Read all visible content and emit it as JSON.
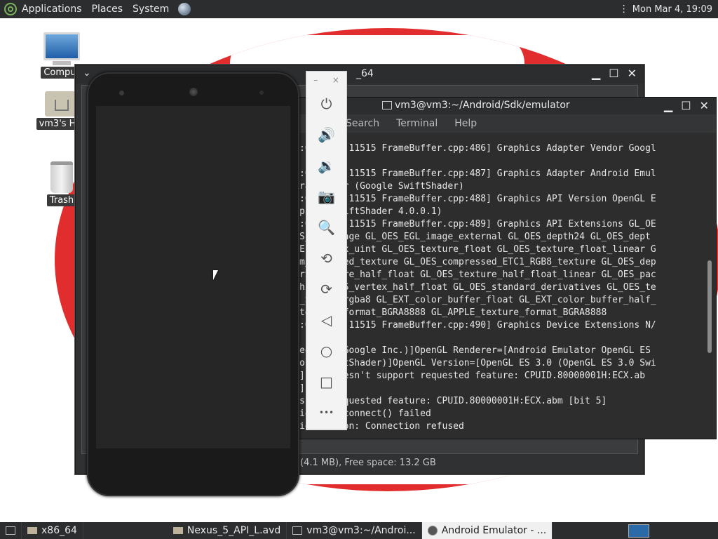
{
  "top_panel": {
    "menus": [
      "Applications",
      "Places",
      "System"
    ],
    "clock": "Mon Mar  4, 19:09"
  },
  "desktop": {
    "icons": [
      {
        "label": "Comput",
        "icon": "computer-icon"
      },
      {
        "label": "vm3's Ho",
        "icon": "home-folder-icon"
      },
      {
        "label": "Trash",
        "icon": "trash-icon"
      }
    ]
  },
  "avd_window": {
    "title": "_64",
    "status": "(4.1 MB), Free space: 13.2 GB"
  },
  "terminal": {
    "title": "vm3@vm3:~/Android/Sdk/emulator",
    "menus": [
      "Search",
      "Terminal",
      "Help"
    ],
    "lines": [
      ":06361   11515 FrameBuffer.cpp:486] Graphics Adapter Vendor Googl",
      "",
      ":06403   11515 FrameBuffer.cpp:487] Graphics Adapter Android Emul",
      "ranslator (Google SwiftShader)",
      ":06409   11515 FrameBuffer.cpp:488] Graphics API Version OpenGL E",
      "p 3.0 SwiftShader 4.0.0.1)",
      ":06413   11515 FrameBuffer.cpp:489] Graphics API Extensions GL_OE",
      "S_EGL_image GL_OES_EGL_image_external GL_OES_depth24 GL_OES_dept",
      "Ent_index_uint GL_OES_texture_float GL_OES_texture_float_linear G",
      "m_paletted_texture GL_OES_compressed_ETC1_RGB8_texture GL_OES_dep",
      "rS_texture_half_float GL_OES_texture_half_float_linear GL_OES_pac",
      "h. GL_OES_vertex_half_float GL_OES_standard_derivatives GL_OES_te",
      "_S_rgb8_rgba8 GL_EXT_color_buffer_float GL_EXT_color_buffer_half_",
      "texture_format_BGRA8888 GL_APPLE_texture_format_BGRA8888",
      ":06429   11515 FrameBuffer.cpp:490] Graphics Device Extensions N/",
      "",
      "eoogle (Google Inc.)]OpenGL Renderer=[Android Emulator OpenGL ES",
      "ole SwiftShader)]OpenGL Version=[OpenGL ES 3.0 (OpenGL ES 3.0 Swi",
      "]host doesn't support requested feature: CPUID.80000001H:ECX.ab",
      "]",
      "sport requested feature: CPUID.80000001H:ECX.abm [bit 5]",
      "iontext_connect() failed",
      "io: Reason: Connection refused"
    ]
  },
  "emulator_toolbar": {
    "buttons": [
      {
        "name": "power-icon",
        "glyph": "⏻"
      },
      {
        "name": "volume-up-icon",
        "glyph": "🔊"
      },
      {
        "name": "volume-down-icon",
        "glyph": "🔉"
      },
      {
        "name": "camera-icon",
        "glyph": "📷"
      },
      {
        "name": "zoom-icon",
        "glyph": "🔍"
      },
      {
        "name": "rotate-left-icon",
        "glyph": "⟲"
      },
      {
        "name": "rotate-right-icon",
        "glyph": "⟳"
      },
      {
        "name": "back-icon",
        "glyph": "◁"
      },
      {
        "name": "home-icon",
        "glyph": "○"
      },
      {
        "name": "overview-icon",
        "glyph": "□"
      },
      {
        "name": "more-icon",
        "glyph": "•••"
      }
    ],
    "minimize": "–",
    "close": "×"
  },
  "taskbar": {
    "items": [
      {
        "label": "x86_64",
        "icon": "folder-icon"
      },
      {
        "label": "Nexus_5_API_L.avd",
        "icon": "folder-icon"
      },
      {
        "label": "vm3@vm3:~/Androi...",
        "icon": "terminal-icon"
      },
      {
        "label": "Android Emulator - ...",
        "icon": "android-icon"
      }
    ]
  },
  "colors": {
    "panel": "#2b2d2e",
    "desktop_logo": "#e12d2d",
    "terminal_bg": "#2d2d2d",
    "toolbar_bg": "#f3f3f3"
  }
}
